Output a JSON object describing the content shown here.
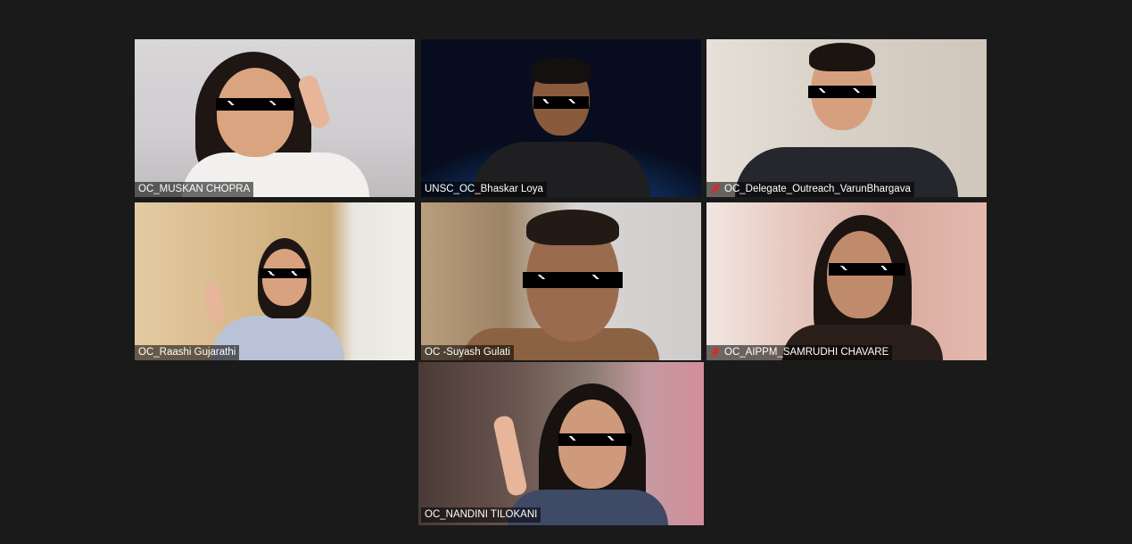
{
  "app": {
    "view": "gallery"
  },
  "colors": {
    "background": "#1a1a1a",
    "active_speaker_border": "#d3e867",
    "muted_icon": "#e02828"
  },
  "participants": [
    {
      "name": "OC_MUSKAN CHOPRA",
      "muted": false
    },
    {
      "name": "UNSC_OC_Bhaskar Loya",
      "muted": false
    },
    {
      "name": "OC_Delegate_Outreach_VarunBhargava",
      "muted": true
    },
    {
      "name": "OC_Raashi Gujarathi",
      "muted": false
    },
    {
      "name": "OC -Suyash Gulati",
      "muted": false
    },
    {
      "name": "OC_AIPPM_SAMRUDHI CHAVARE",
      "muted": true
    },
    {
      "name": "OC_NANDINI TILOKANI",
      "muted": false,
      "active_speaker": true
    }
  ]
}
